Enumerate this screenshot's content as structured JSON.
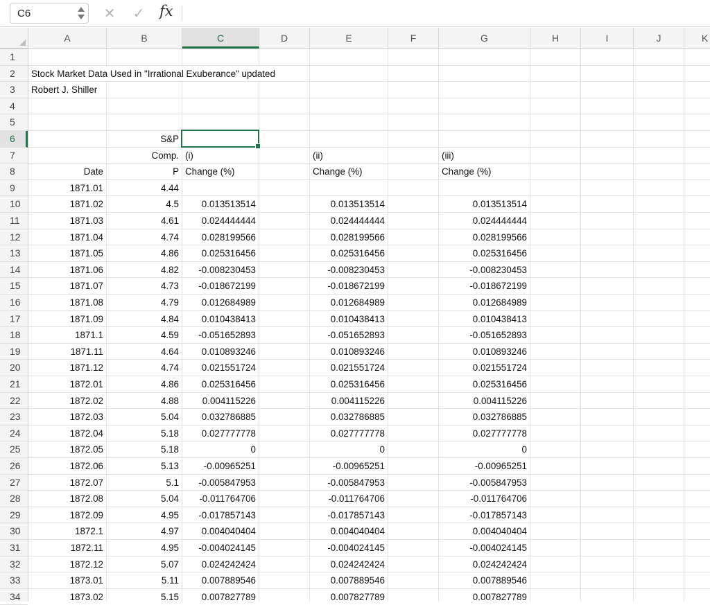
{
  "formula_bar": {
    "name_box": "C6",
    "cancel_icon": "✕",
    "enter_icon": "✓",
    "fx_label": "fx",
    "formula": ""
  },
  "columns": [
    "A",
    "B",
    "C",
    "D",
    "E",
    "F",
    "G",
    "H",
    "I",
    "J",
    "K"
  ],
  "selected_column": "C",
  "selected_row": "6",
  "header": {
    "title": "Stock Market Data Used in \"Irrational Exuberance\" updated",
    "author": "Robert J. Shiller",
    "sp_label": "S&P",
    "comp_label": "Comp.",
    "p_label": "P",
    "date_label": "Date",
    "col_c_i": "(i)",
    "col_c_change": "Change (%)",
    "col_e_ii": "(ii)",
    "col_e_change": "Change (%)",
    "col_g_iii": "(iii)",
    "col_g_change": "Change (%)"
  },
  "rows": [
    {
      "r": "9",
      "date": "1871.01",
      "p": "4.44",
      "c": "",
      "e": "",
      "g": ""
    },
    {
      "r": "10",
      "date": "1871.02",
      "p": "4.5",
      "c": "0.013513514",
      "e": "0.013513514",
      "g": "0.013513514"
    },
    {
      "r": "11",
      "date": "1871.03",
      "p": "4.61",
      "c": "0.024444444",
      "e": "0.024444444",
      "g": "0.024444444"
    },
    {
      "r": "12",
      "date": "1871.04",
      "p": "4.74",
      "c": "0.028199566",
      "e": "0.028199566",
      "g": "0.028199566"
    },
    {
      "r": "13",
      "date": "1871.05",
      "p": "4.86",
      "c": "0.025316456",
      "e": "0.025316456",
      "g": "0.025316456"
    },
    {
      "r": "14",
      "date": "1871.06",
      "p": "4.82",
      "c": "-0.008230453",
      "e": "-0.008230453",
      "g": "-0.008230453"
    },
    {
      "r": "15",
      "date": "1871.07",
      "p": "4.73",
      "c": "-0.018672199",
      "e": "-0.018672199",
      "g": "-0.018672199"
    },
    {
      "r": "16",
      "date": "1871.08",
      "p": "4.79",
      "c": "0.012684989",
      "e": "0.012684989",
      "g": "0.012684989"
    },
    {
      "r": "17",
      "date": "1871.09",
      "p": "4.84",
      "c": "0.010438413",
      "e": "0.010438413",
      "g": "0.010438413"
    },
    {
      "r": "18",
      "date": "1871.1",
      "p": "4.59",
      "c": "-0.051652893",
      "e": "-0.051652893",
      "g": "-0.051652893"
    },
    {
      "r": "19",
      "date": "1871.11",
      "p": "4.64",
      "c": "0.010893246",
      "e": "0.010893246",
      "g": "0.010893246"
    },
    {
      "r": "20",
      "date": "1871.12",
      "p": "4.74",
      "c": "0.021551724",
      "e": "0.021551724",
      "g": "0.021551724"
    },
    {
      "r": "21",
      "date": "1872.01",
      "p": "4.86",
      "c": "0.025316456",
      "e": "0.025316456",
      "g": "0.025316456"
    },
    {
      "r": "22",
      "date": "1872.02",
      "p": "4.88",
      "c": "0.004115226",
      "e": "0.004115226",
      "g": "0.004115226"
    },
    {
      "r": "23",
      "date": "1872.03",
      "p": "5.04",
      "c": "0.032786885",
      "e": "0.032786885",
      "g": "0.032786885"
    },
    {
      "r": "24",
      "date": "1872.04",
      "p": "5.18",
      "c": "0.027777778",
      "e": "0.027777778",
      "g": "0.027777778"
    },
    {
      "r": "25",
      "date": "1872.05",
      "p": "5.18",
      "c": "0",
      "e": "0",
      "g": "0"
    },
    {
      "r": "26",
      "date": "1872.06",
      "p": "5.13",
      "c": "-0.00965251",
      "e": "-0.00965251",
      "g": "-0.00965251"
    },
    {
      "r": "27",
      "date": "1872.07",
      "p": "5.1",
      "c": "-0.005847953",
      "e": "-0.005847953",
      "g": "-0.005847953"
    },
    {
      "r": "28",
      "date": "1872.08",
      "p": "5.04",
      "c": "-0.011764706",
      "e": "-0.011764706",
      "g": "-0.011764706"
    },
    {
      "r": "29",
      "date": "1872.09",
      "p": "4.95",
      "c": "-0.017857143",
      "e": "-0.017857143",
      "g": "-0.017857143"
    },
    {
      "r": "30",
      "date": "1872.1",
      "p": "4.97",
      "c": "0.004040404",
      "e": "0.004040404",
      "g": "0.004040404"
    },
    {
      "r": "31",
      "date": "1872.11",
      "p": "4.95",
      "c": "-0.004024145",
      "e": "-0.004024145",
      "g": "-0.004024145"
    },
    {
      "r": "32",
      "date": "1872.12",
      "p": "5.07",
      "c": "0.024242424",
      "e": "0.024242424",
      "g": "0.024242424"
    },
    {
      "r": "33",
      "date": "1873.01",
      "p": "5.11",
      "c": "0.007889546",
      "e": "0.007889546",
      "g": "0.007889546"
    },
    {
      "r": "34",
      "date": "1873.02",
      "p": "5.15",
      "c": "0.007827789",
      "e": "0.007827789",
      "g": "0.007827789"
    }
  ],
  "colors": {
    "accent": "#217346"
  }
}
